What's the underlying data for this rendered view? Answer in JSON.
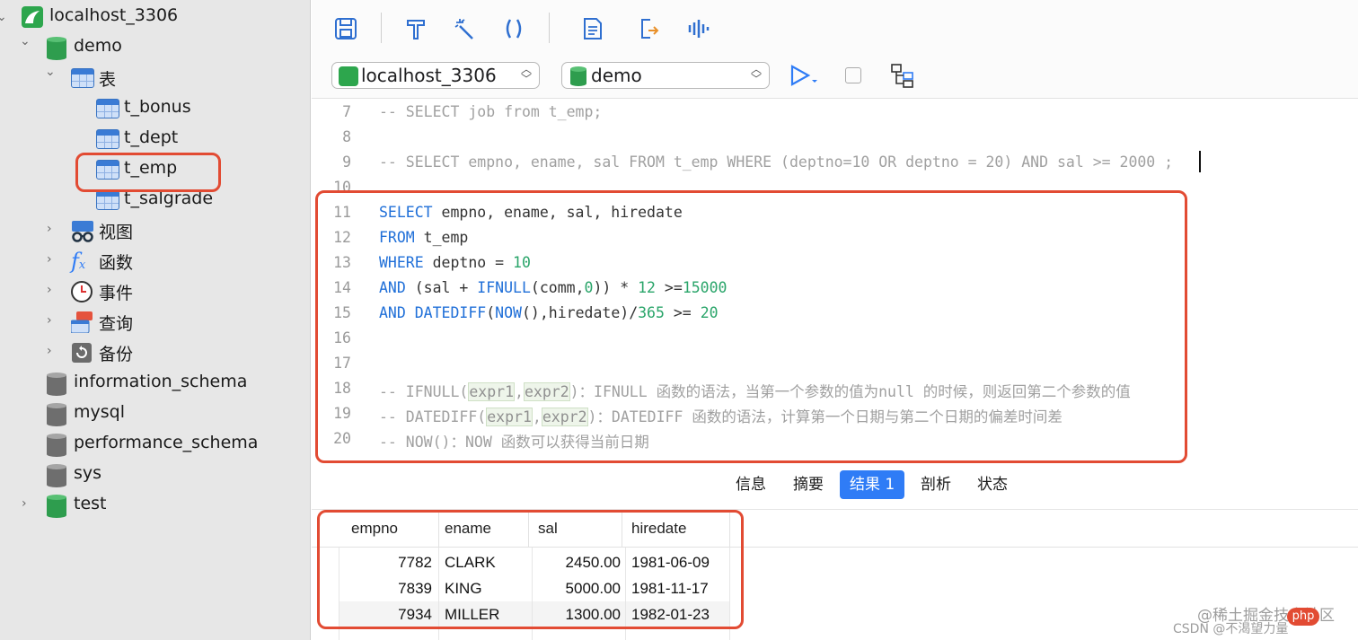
{
  "sidebar": {
    "connection": "localhost_3306",
    "db_demo": "demo",
    "tables_group": "表",
    "tables": [
      "t_bonus",
      "t_dept",
      "t_emp",
      "t_salgrade"
    ],
    "groups": [
      "视图",
      "函数",
      "事件",
      "查询",
      "备份"
    ],
    "other_dbs": [
      "information_schema",
      "mysql",
      "performance_schema",
      "sys",
      "test"
    ]
  },
  "toolbar": {
    "connection_select": "localhost_3306",
    "database_select": "demo"
  },
  "editor": {
    "line_numbers": [
      "7",
      "8",
      "9",
      "10",
      "11",
      "12",
      "13",
      "14",
      "15",
      "16",
      "17",
      "18",
      "19",
      "20"
    ]
  },
  "result_tabs": [
    "信息",
    "摘要",
    "结果 1",
    "剖析",
    "状态"
  ],
  "active_result_tab": "结果 1",
  "grid": {
    "columns": [
      "empno",
      "ename",
      "sal",
      "hiredate"
    ],
    "rows": [
      [
        "7782",
        "CLARK",
        "2450.00",
        "1981-06-09"
      ],
      [
        "7839",
        "KING",
        "5000.00",
        "1981-11-17"
      ],
      [
        "7934",
        "MILLER",
        "1300.00",
        "1982-01-23"
      ]
    ]
  },
  "watermarks": {
    "juejin": "@稀土掘金技术社区",
    "csdn": "CSDN @不渴望力量",
    "php": "php"
  },
  "colors": {
    "highlight_red": "#e24b33",
    "keyword_blue": "#1f6fd8",
    "number_green": "#2aa56a",
    "active_tab": "#2f7cf6",
    "db_green": "#2e9d4e"
  }
}
